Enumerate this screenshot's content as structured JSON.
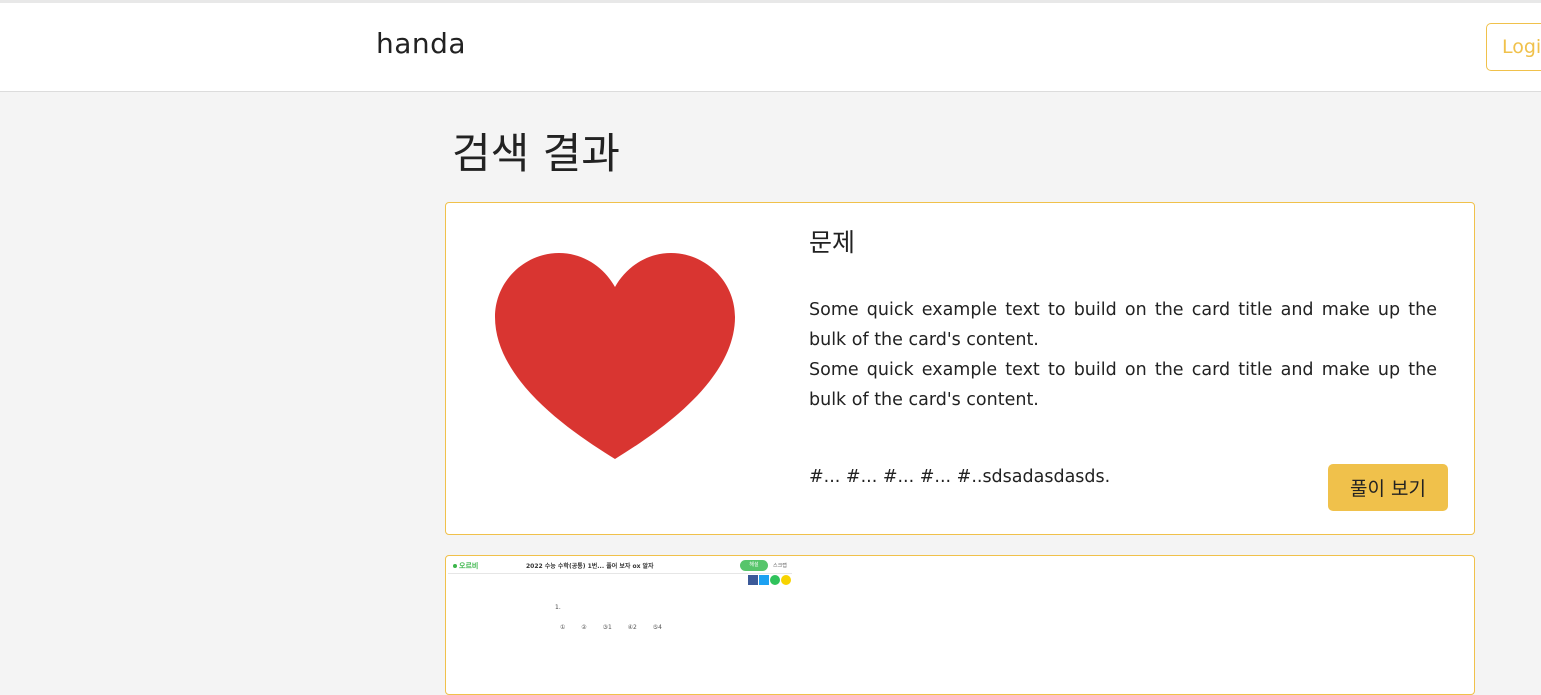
{
  "navbar": {
    "brand": "handa",
    "login_label": "Login"
  },
  "page": {
    "title": "검색 결과"
  },
  "results": [
    {
      "title": "문제",
      "text_lines": [
        "Some quick example text to build on the card title and make up the bulk of the card's content.",
        "Some quick example text to build on the card title and make up the bulk of the card's content."
      ],
      "tags": "#... #... #... #... #..sdsadasdasds.",
      "button_label": "풀이 보기",
      "image_icon": "heart-icon"
    },
    {
      "thumbnail": {
        "brand": "오르비",
        "title": "2022 수능 수학(공통) 1번... 풀어 보자 ox 알자",
        "button": "해설",
        "small": "스크랩",
        "problem": "1.",
        "choices": "① ② ③1 ④2 ⑤4"
      }
    }
  ],
  "colors": {
    "accent": "#f0c14b",
    "heart": "#d93531",
    "background": "#f4f4f4"
  }
}
